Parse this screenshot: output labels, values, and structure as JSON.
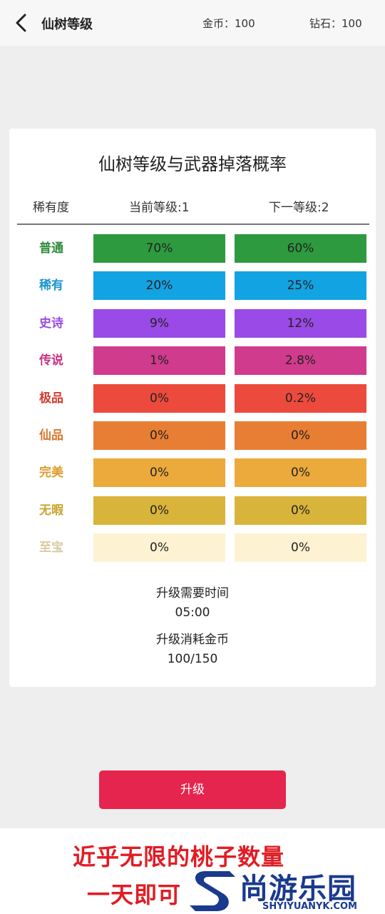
{
  "header": {
    "title": "仙树等级",
    "gold": "金币：100",
    "diamond": "钻石：100"
  },
  "card": {
    "title": "仙树等级与武器掉落概率",
    "col_rarity": "稀有度",
    "col_current": "当前等级:1",
    "col_next": "下一等级:2",
    "rows": [
      {
        "rarity": "普通",
        "current": "70%",
        "next": "60%",
        "color": "#2e9a3f",
        "text_color": "#2e8b3a"
      },
      {
        "rarity": "稀有",
        "current": "20%",
        "next": "25%",
        "color": "#12a3e3",
        "text_color": "#1b95cf"
      },
      {
        "rarity": "史诗",
        "current": "9%",
        "next": "12%",
        "color": "#9a4ae6",
        "text_color": "#9a4ae6"
      },
      {
        "rarity": "传说",
        "current": "1%",
        "next": "2.8%",
        "color": "#d03b8d",
        "text_color": "#c8327e"
      },
      {
        "rarity": "极品",
        "current": "0%",
        "next": "0.2%",
        "color": "#ec4a3c",
        "text_color": "#d23b2d"
      },
      {
        "rarity": "仙品",
        "current": "0%",
        "next": "0%",
        "color": "#e87e33",
        "text_color": "#d8772d"
      },
      {
        "rarity": "完美",
        "current": "0%",
        "next": "0%",
        "color": "#ebaa3b",
        "text_color": "#dc9c2c"
      },
      {
        "rarity": "无暇",
        "current": "0%",
        "next": "0%",
        "color": "#d9b43a",
        "text_color": "#caa52f"
      },
      {
        "rarity": "至宝",
        "current": "0%",
        "next": "0%",
        "color": "#fdf2d2",
        "text_color": "#d8c9a0"
      }
    ],
    "upgrade_time_label": "升级需要时间",
    "upgrade_time_value": "05:00",
    "upgrade_cost_label": "升级消耗金币",
    "upgrade_cost_value": "100/150"
  },
  "upgrade_button": "升级",
  "banner": {
    "line1": "近乎无限的桃子数量",
    "line2": "一天即可",
    "watermark": "尚游乐园",
    "watermark_url": "SHYIYUANYK.COM"
  }
}
